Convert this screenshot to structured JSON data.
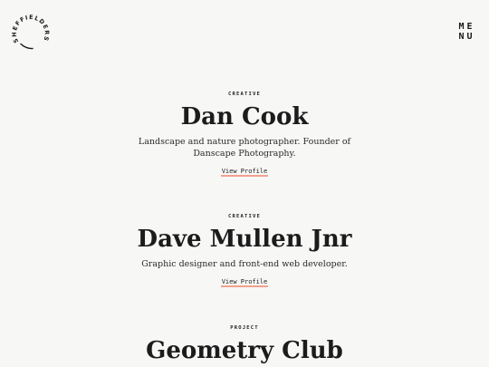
{
  "header": {
    "logo_text": "SHEFFIELDERS",
    "menu_label_line1": "ME",
    "menu_label_line2": "NU"
  },
  "entries": [
    {
      "label": "CREATIVE",
      "name": "Dan Cook",
      "description": "Landscape and nature photographer. Founder of Danscape Photography.",
      "link": "View Profile"
    },
    {
      "label": "CREATIVE",
      "name": "Dave Mullen Jnr",
      "description": "Graphic designer and front-end web developer.",
      "link": "View Profile"
    },
    {
      "label": "PROJECT",
      "name": "Geometry Club"
    }
  ],
  "colors": {
    "background": "#f7f7f6",
    "text": "#1a1a1a",
    "link_underline": "#f2a08e"
  }
}
